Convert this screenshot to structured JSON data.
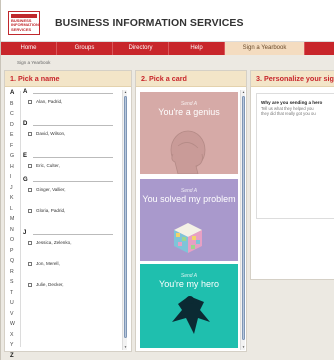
{
  "header": {
    "logo_lines": [
      "BUSINESS",
      "INFORMATION",
      "SERVICES"
    ],
    "brand": "BUSINESS INFORMATION SERVICES"
  },
  "nav": {
    "items": [
      "Home",
      "Groups",
      "Directory",
      "Help",
      "Sign a Yearbook",
      ""
    ],
    "active": "Sign a Yearbook"
  },
  "breadcrumb": "Sign a Yearbook",
  "panel1": {
    "title": "1. Pick a name",
    "alphabet": [
      "A",
      "B",
      "C",
      "D",
      "E",
      "F",
      "G",
      "H",
      "I",
      "J",
      "K",
      "L",
      "M",
      "N",
      "O",
      "P",
      "Q",
      "R",
      "S",
      "T",
      "U",
      "V",
      "W",
      "X",
      "Y",
      "Z"
    ],
    "groups": [
      {
        "letter": "A",
        "names": [
          "Alan, Padrid,"
        ]
      },
      {
        "letter": "D",
        "names": [
          "David, Wilson,"
        ]
      },
      {
        "letter": "E",
        "names": [
          "Eric, Culter,"
        ]
      },
      {
        "letter": "G",
        "names": [
          "Ginger, Vallier,",
          "Gloria, Padrid,"
        ]
      },
      {
        "letter": "J",
        "names": [
          "Jessica, Zelenko,",
          "Jon, Merell,",
          "Julie, Decker,"
        ]
      }
    ]
  },
  "panel2": {
    "title": "2. Pick a card",
    "cards": [
      {
        "send": "Send A",
        "message": "You're a genius"
      },
      {
        "send": "Send A",
        "message": "You solved my problem"
      },
      {
        "send": "Send A",
        "message": "You're my hero"
      }
    ]
  },
  "panel3": {
    "title": "3. Personalize your sig",
    "question": "Why are you sending a hero",
    "hint_lines": [
      "Tell us what they helped you",
      "they did that really got you ou"
    ]
  },
  "colors": {
    "brand_red": "#c8262b",
    "panel_header": "#f3e5c8",
    "card_genius": "#d6aaa7",
    "card_problem": "#a999cc",
    "card_hero": "#1fbfae"
  }
}
